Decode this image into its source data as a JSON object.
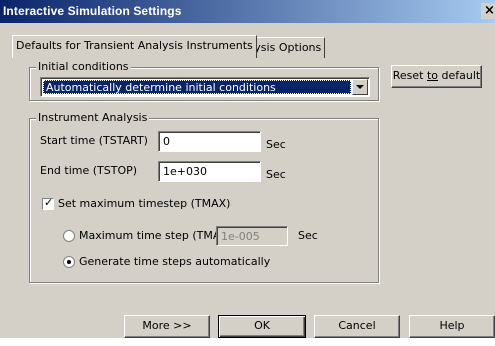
{
  "window": {
    "title": "Interactive Simulation Settings",
    "close_glyph": "×"
  },
  "tabs": [
    {
      "label": "Defaults for Transient Analysis Instruments",
      "active": true
    },
    {
      "label": "Analysis Options",
      "active": false
    }
  ],
  "initial_conditions": {
    "group_label": "Initial conditions",
    "selected": "Automatically determine initial conditions"
  },
  "reset_button": {
    "label_pre": "Reset ",
    "label_u": "to",
    "label_post": " default"
  },
  "instrument_analysis": {
    "group_label": "Instrument Analysis",
    "start_label": "Start time (TSTART)",
    "start_value": "0",
    "start_unit": "Sec",
    "end_label": "End time (TSTOP)",
    "end_value": "1e+030",
    "end_unit": "Sec",
    "tmax_check_label": "Set maximum timestep (TMAX)",
    "tmax_checked": true,
    "max_step_label": "Maximum time step (TMAX)",
    "max_step_value": "1e-005",
    "max_step_unit": "Sec",
    "auto_label": "Generate time steps automatically",
    "auto_selected": true
  },
  "buttons": {
    "more": "More >>",
    "ok": "OK",
    "cancel": "Cancel",
    "help": "Help"
  },
  "colors": {
    "titlebar_start": "#0a246a",
    "titlebar_end": "#a6caf0",
    "face": "#d4d0c8",
    "selection": "#0a246a"
  }
}
